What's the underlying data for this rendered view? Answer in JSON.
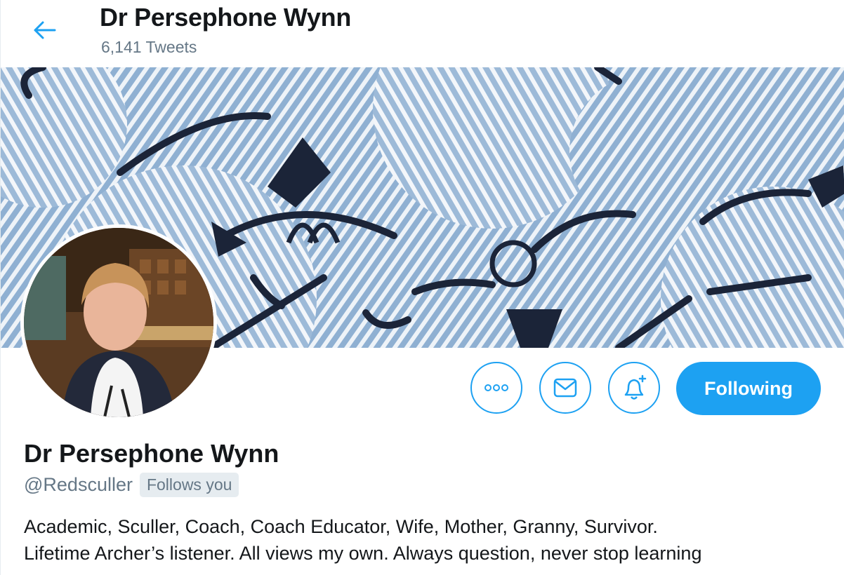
{
  "header": {
    "name": "Dr Persephone Wynn",
    "tweet_count": "6,141 Tweets"
  },
  "icons": {
    "back": "back-arrow-icon",
    "more": "more-dots-icon",
    "message": "envelope-icon",
    "notify": "bell-plus-icon"
  },
  "actions": {
    "follow_label": "Following"
  },
  "profile": {
    "name": "Dr Persephone Wynn",
    "handle": "@Redsculler",
    "follows_you": "Follows you",
    "bio_line1": "Academic, Sculler, Coach, Coach Educator, Wife, Mother, Granny, Survivor.",
    "bio_line2": "Lifetime Archer’s listener. All views my own. Always question, never stop learning"
  },
  "colors": {
    "accent": "#1da1f2",
    "text": "#14171a",
    "muted": "#657786",
    "badge_bg": "#e6ecf0",
    "banner_blue": "#8fb0d2",
    "banner_navy": "#1b2438"
  }
}
